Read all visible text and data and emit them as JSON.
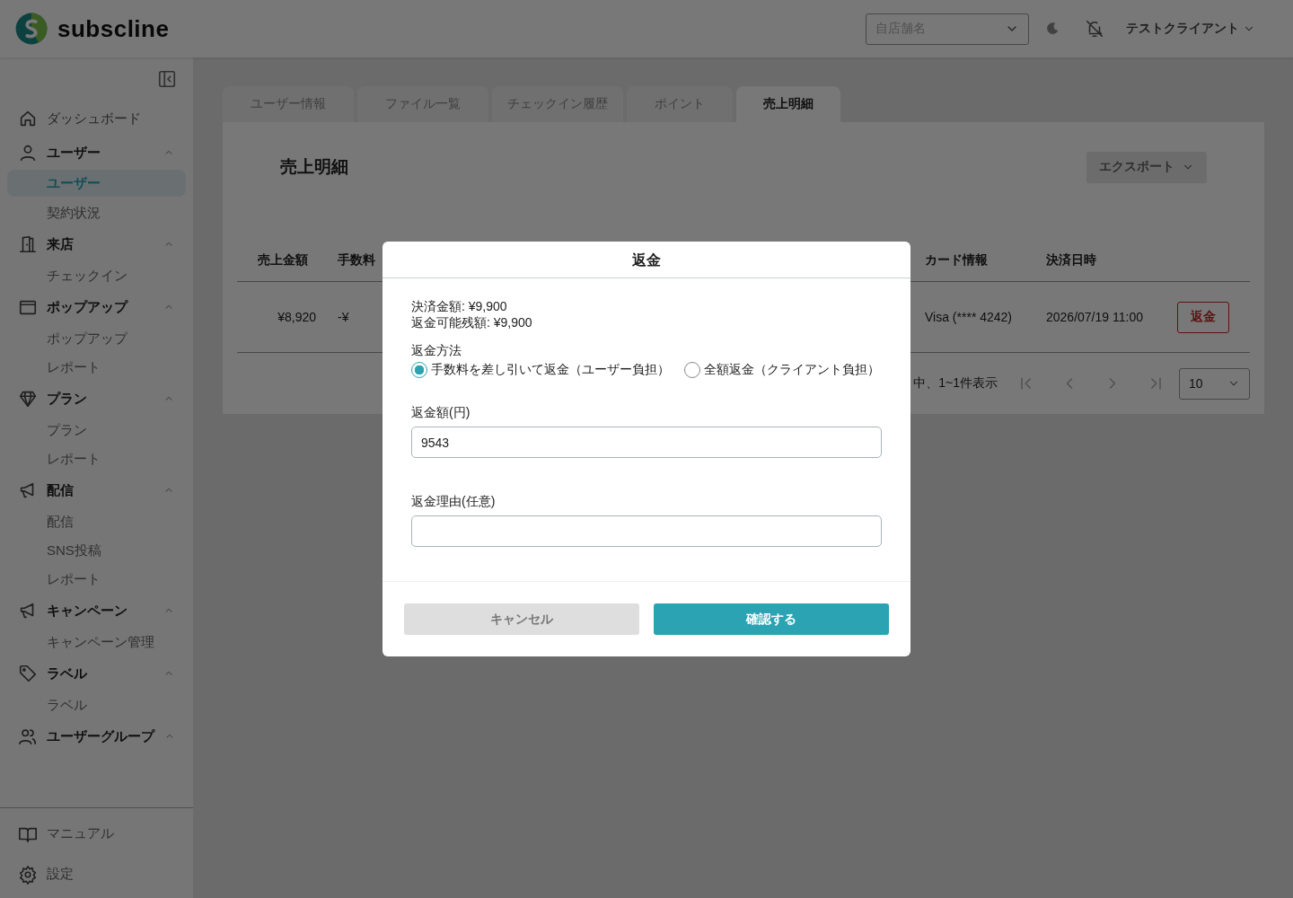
{
  "header": {
    "logo_text": "subscline",
    "store_select": {
      "placeholder": "自店舗名"
    },
    "user_menu": {
      "label": "テストクライアント"
    }
  },
  "sidebar": {
    "items": [
      {
        "label": "ダッシュボード",
        "expanded": false
      },
      {
        "label": "ユーザー",
        "expanded": true,
        "children": [
          {
            "label": "ユーザー",
            "selected": true
          },
          {
            "label": "契約状況",
            "selected": false
          }
        ]
      },
      {
        "label": "来店",
        "expanded": true,
        "children": [
          {
            "label": "チェックイン",
            "selected": false
          }
        ]
      },
      {
        "label": "ポップアップ",
        "expanded": true,
        "children": [
          {
            "label": "ポップアップ",
            "selected": false
          },
          {
            "label": "レポート",
            "selected": false
          }
        ]
      },
      {
        "label": "プラン",
        "expanded": true,
        "children": [
          {
            "label": "プラン",
            "selected": false
          },
          {
            "label": "レポート",
            "selected": false
          }
        ]
      },
      {
        "label": "配信",
        "expanded": true,
        "children": [
          {
            "label": "配信",
            "selected": false
          },
          {
            "label": "SNS投稿",
            "selected": false
          },
          {
            "label": "レポート",
            "selected": false
          }
        ]
      },
      {
        "label": "キャンペーン",
        "expanded": true,
        "children": [
          {
            "label": "キャンペーン管理",
            "selected": false
          }
        ]
      },
      {
        "label": "ラベル",
        "expanded": true,
        "children": [
          {
            "label": "ラベル",
            "selected": false
          }
        ]
      },
      {
        "label": "ユーザーグループ",
        "expanded": true
      }
    ],
    "footer_items": [
      {
        "label": "マニュアル"
      },
      {
        "label": "設定"
      }
    ]
  },
  "tabs": [
    {
      "label": "ユーザー情報",
      "selected": false
    },
    {
      "label": "ファイル一覧",
      "selected": false
    },
    {
      "label": "チェックイン履歴",
      "selected": false
    },
    {
      "label": "ポイント",
      "selected": false
    },
    {
      "label": "売上明細",
      "selected": true
    }
  ],
  "panel": {
    "title": "売上明細",
    "export_button": "エクスポート"
  },
  "table": {
    "columns": [
      "売上金額",
      "手数料",
      "カード情報",
      "決済日時"
    ],
    "rows": [
      {
        "cells": [
          "¥8,920",
          "-¥",
          "Visa (**** 4242)",
          "2026/07/19 11:00"
        ],
        "action": "返金"
      }
    ]
  },
  "pagination": {
    "summary": "中、1~1件表示",
    "page_size": "10"
  },
  "dialog": {
    "title": "返金",
    "info": [
      "決済金額: ¥9,900",
      "返金可能残額: ¥9,900"
    ],
    "method_label": "返金方法",
    "methods": [
      {
        "label": "手数料を差し引いて返金（ユーザー負担）",
        "selected": true
      },
      {
        "label": "全額返金（クライアント負担）",
        "selected": false
      }
    ],
    "amount": {
      "label": "返金額(円)",
      "value": "9543"
    },
    "reason": {
      "label": "返金理由(任意)"
    },
    "buttons": [
      {
        "label": "キャンセル",
        "kind": "secondary"
      },
      {
        "label": "確認する",
        "kind": "primary"
      }
    ]
  }
}
